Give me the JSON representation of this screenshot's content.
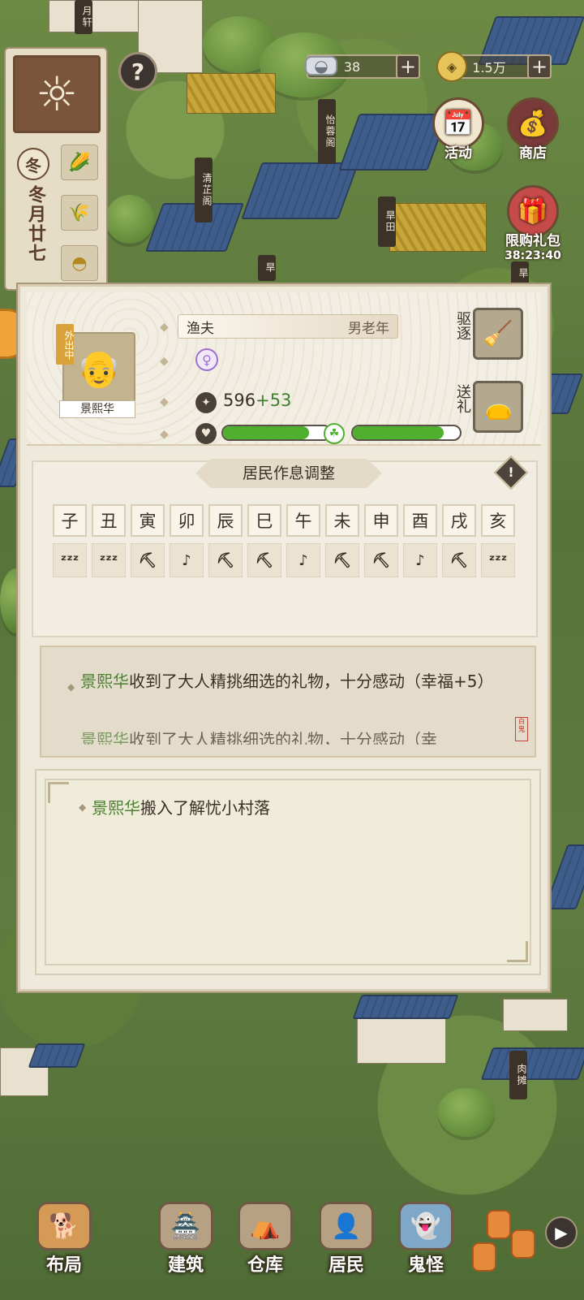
{
  "map": {
    "signs": [
      "月轩",
      "怡蓉阁",
      "清芷阁",
      "旱田",
      "旱",
      "旱",
      "肉摊"
    ]
  },
  "calendar": {
    "season": "冬",
    "date": "冬月廿七"
  },
  "currency": {
    "silver": "38",
    "coins": "1.5万"
  },
  "top_buttons": {
    "activity": "活动",
    "shop": "商店",
    "gift_pack": "限购礼包",
    "gift_timer": "38:23:40"
  },
  "resident": {
    "away_badge": "外出中",
    "name": "景熙华",
    "job": "渔夫",
    "gender_age": "男老年",
    "stat_value": "596",
    "stat_bonus": "+53",
    "health_level": 0.8,
    "happiness_level": 0.85,
    "expel_label": "驱逐",
    "gift_label": "送礼"
  },
  "schedule": {
    "title": "居民作息调整",
    "hours": [
      "子",
      "丑",
      "寅",
      "卯",
      "辰",
      "巳",
      "午",
      "未",
      "申",
      "酉",
      "戌",
      "亥"
    ],
    "activities": [
      "zzz",
      "zzz",
      "work",
      "leisure",
      "work",
      "work",
      "leisure",
      "work",
      "work",
      "leisure",
      "work",
      "zzz"
    ]
  },
  "logs": {
    "recent_name": "景熙华",
    "recent_text": "收到了大人精挑细选的礼物，十分感动（幸福+5）",
    "recent_name_2": "景熙华",
    "recent_text_2": "收到了大人精挑细选的礼物，十分感动（幸",
    "seal": "百鬼",
    "history_name": "景熙华",
    "history_text": "搬入了解忧小村落"
  },
  "nav": {
    "layout": "布局",
    "build": "建筑",
    "storage": "仓库",
    "residents": "居民",
    "ghosts": "鬼怪"
  }
}
